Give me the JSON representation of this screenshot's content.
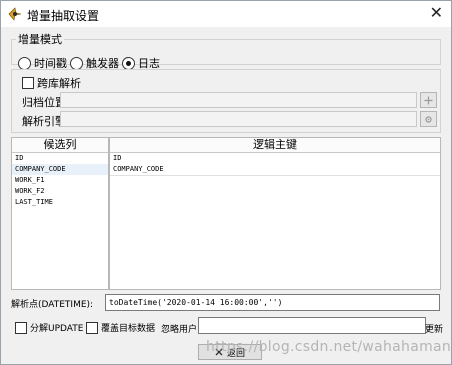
{
  "window": {
    "title": "增量抽取设置",
    "close_glyph": "✕"
  },
  "mode": {
    "legend": "增量模式",
    "options": [
      {
        "label": "时间戳",
        "selected": false
      },
      {
        "label": "触发器",
        "selected": false
      },
      {
        "label": "日志",
        "selected": true
      }
    ]
  },
  "cross_db": {
    "label": "跨库解析",
    "checked": false,
    "archive_label": "归档位置:",
    "engine_label": "解析引擎:"
  },
  "candidates": {
    "header": "候选列",
    "items": [
      "ID",
      "COMPANY_CODE",
      "WORK_F1",
      "WORK_F2",
      "LAST_TIME"
    ],
    "selected_index": 1
  },
  "logical_keys": {
    "header": "逻辑主键",
    "items": [
      "ID",
      "COMPANY_CODE"
    ]
  },
  "parse_point": {
    "label": "解析点(DATETIME):",
    "value": "toDateTime('2020-01-14 16:00:00','')"
  },
  "options": {
    "split_update_label": "分解UPDATE",
    "overwrite_label": "覆盖目标数据",
    "ignore_user_label": "忽略用户",
    "update_label": "更新"
  },
  "return_button": {
    "label": "返回"
  },
  "watermark": "https://blog.csdn.net/wahahaman"
}
